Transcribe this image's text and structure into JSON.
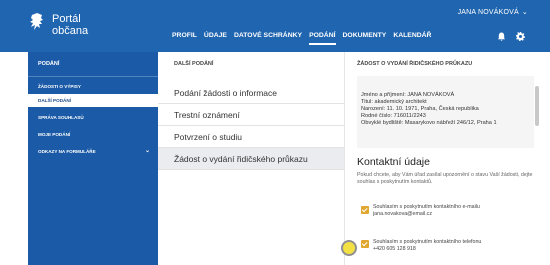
{
  "header": {
    "brand_line1": "Portál",
    "brand_line2": "občana",
    "user": "JANA NOVÁKOVÁ",
    "nav": [
      "PROFIL",
      "ÚDAJE",
      "DATOVÉ SCHRÁNKY",
      "PODÁNÍ",
      "DOKUMENTY",
      "KALENDÁŘ"
    ],
    "active_nav": "PODÁNÍ"
  },
  "sidebar": {
    "title": "PODÁNÍ",
    "items": [
      "ŽÁDOSTI O VÝPISY",
      "DALŠÍ PODÁNÍ",
      "SPRÁVA SOUHLASŮ",
      "MOJE PODÁNÍ",
      "ODKAZY NA FORMULÁŘE"
    ]
  },
  "middle": {
    "title": "DALŠÍ PODÁNÍ",
    "items": [
      "Podání žádosti o informace",
      "Trestní oznámení",
      "Potvrzení o studiu",
      "Žádost o vydání řidičského průkazu"
    ]
  },
  "detail": {
    "title": "ŽÁDOST O VYDÁNÍ ŘIDIČSKÉHO PRŮKAZU",
    "lines": [
      "Jméno a příjmení: JANA NOVÁKOVÁ",
      "Titul: akademický architekt",
      "Narození: 11. 10. 1971, Praha, Česká republika",
      "Rodné číslo: 716011/2243",
      "Obvyklé bydliště: Masarykovo nábřeží 246/12, Praha 1"
    ],
    "contact_heading": "Kontaktní údaje",
    "note": "Pokud chcete, aby Vám úřad zasílal upozornění o stavu Vaší žádosti, dejte souhlas s poskytnutím kontaktů.",
    "consents": [
      {
        "label": "Souhlasím s poskytnutím kontaktního e-mailu",
        "value": "jana.novakova@email.cz"
      },
      {
        "label": "Souhlasím s poskytnutím kontaktního telefonu",
        "value": "+420 605 128 918"
      }
    ]
  },
  "colors": {
    "primary": "#2065b0",
    "sidebar": "#1a5aa6",
    "check": "#e0a830"
  }
}
